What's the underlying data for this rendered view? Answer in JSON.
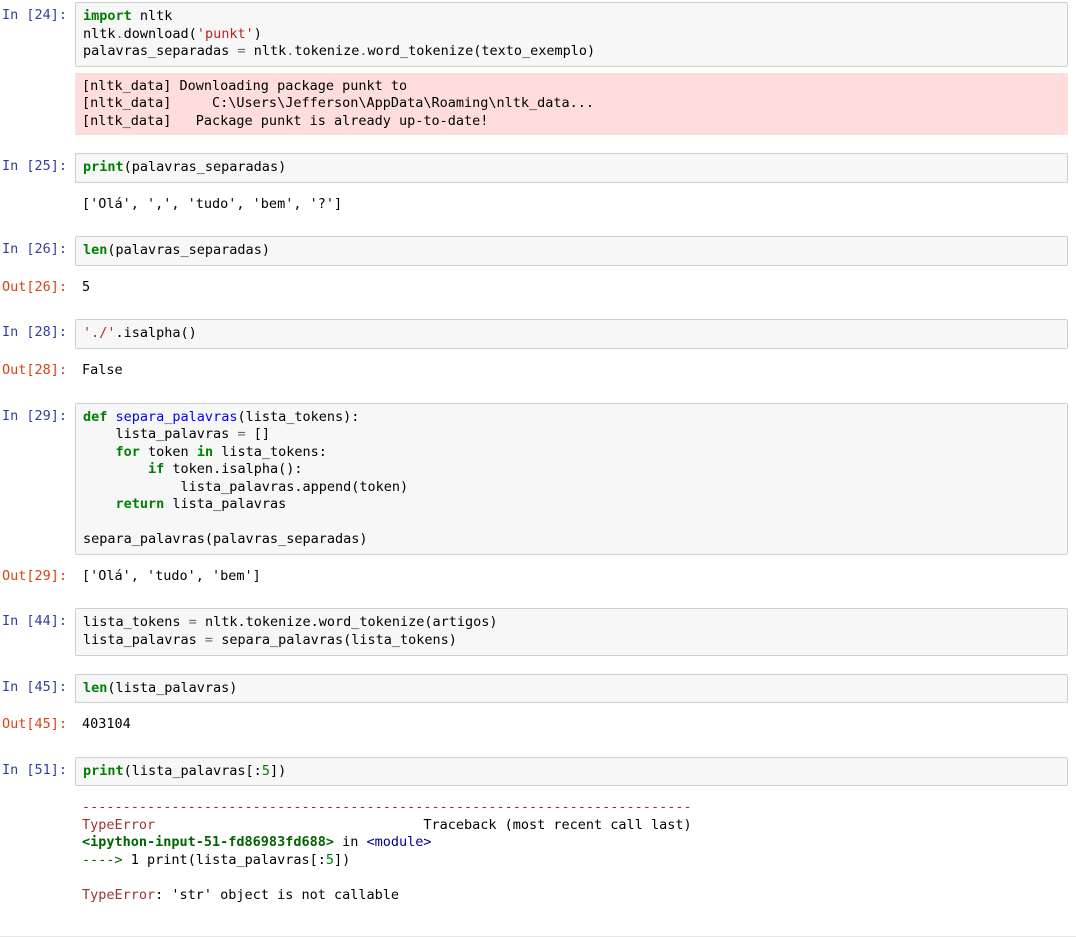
{
  "cells": {
    "c24": {
      "in_prompt": "In [24]:",
      "code": {
        "l1_kw": "import",
        "l1_mod": " nltk",
        "l2a": "nltk",
        "l2b": ".",
        "l2c": "download(",
        "l2_str": "'punkt'",
        "l2d": ")",
        "l3a": "palavras_separadas ",
        "l3_op": "=",
        "l3b": " nltk",
        "l3c": ".",
        "l3d": "tokenize",
        "l3e": ".",
        "l3f": "word_tokenize(texto_exemplo)"
      },
      "stderr": "[nltk_data] Downloading package punkt to\n[nltk_data]     C:\\Users\\Jefferson\\AppData\\Roaming\\nltk_data...\n[nltk_data]   Package punkt is already up-to-date!"
    },
    "c25": {
      "in_prompt": "In [25]:",
      "code_print": "print",
      "code_open": "(palavras_separadas)",
      "output": "['Olá', ',', 'tudo', 'bem', '?']"
    },
    "c26": {
      "in_prompt": "In [26]:",
      "out_prompt": "Out[26]:",
      "code_fn": "len",
      "code_open": "(palavras_separadas)",
      "output": "5"
    },
    "c28": {
      "in_prompt": "In [28]:",
      "out_prompt": "Out[28]:",
      "code_str": "'./'",
      "code_rest": ".isalpha()",
      "output": "False"
    },
    "c29": {
      "in_prompt": "In [29]:",
      "out_prompt": "Out[29]:",
      "code": {
        "l1_def": "def",
        "l1_sp": " ",
        "l1_fn": "separa_palavras",
        "l1_rest": "(lista_tokens):",
        "l2_indent": "    lista_palavras ",
        "l2_op": "=",
        "l2_rest": " []",
        "l3_indent": "    ",
        "l3_for": "for",
        "l3_a": " token ",
        "l3_in": "in",
        "l3_b": " lista_tokens:",
        "l4_indent": "        ",
        "l4_if": "if",
        "l4_rest": " token.isalpha():",
        "l5": "            lista_palavras.append(token)",
        "l6_indent": "    ",
        "l6_ret": "return",
        "l6_rest": " lista_palavras",
        "blank": "",
        "l8": "separa_palavras(palavras_separadas)"
      },
      "output": "['Olá', 'tudo', 'bem']"
    },
    "c44": {
      "in_prompt": "In [44]:",
      "l1a": "lista_tokens ",
      "l1_op": "=",
      "l1b": " nltk",
      "l1c": ".tokenize.word_tokenize(artigos)",
      "l2a": "lista_palavras ",
      "l2_op": "=",
      "l2b": " separa_palavras(lista_tokens)"
    },
    "c45": {
      "in_prompt": "In [45]:",
      "out_prompt": "Out[45]:",
      "code_fn": "len",
      "code_open": "(lista_palavras)",
      "output": "403104"
    },
    "c51": {
      "in_prompt": "In [51]:",
      "code_print": "print",
      "code_a": "(lista_palavras[:",
      "code_num": "5",
      "code_b": "])",
      "tb": {
        "dash": "---------------------------------------------------------------------------",
        "err_name": "TypeError",
        "trace_label": "                                 Traceback (most recent call last)",
        "loc": "<ipython-input-51-fd86983fd688>",
        "in_word": " in ",
        "module": "<module>",
        "arrow": "----> ",
        "lineno": "1",
        "line_code_a": " print(lista_palavras[:",
        "line_code_num": "5",
        "line_code_b": "])",
        "err_name2": "TypeError",
        "err_msg": ": 'str' object is not callable"
      }
    }
  }
}
